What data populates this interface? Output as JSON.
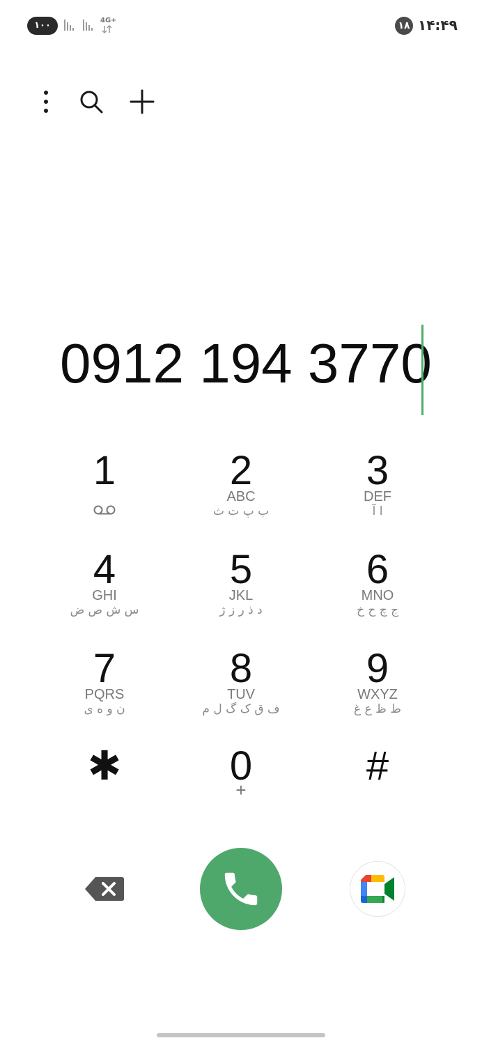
{
  "status_bar": {
    "battery": "۱۰۰",
    "network": "4G+",
    "notification_count": "۱۸",
    "time": "۱۴:۴۹"
  },
  "dialer": {
    "number": "0912 194 3770"
  },
  "keypad": {
    "keys": [
      {
        "digit": "1",
        "letters": "",
        "farsi": ""
      },
      {
        "digit": "2",
        "letters": "ABC",
        "farsi": "ب پ ت ث"
      },
      {
        "digit": "3",
        "letters": "DEF",
        "farsi": "ا آ"
      },
      {
        "digit": "4",
        "letters": "GHI",
        "farsi": "س ش ص ض"
      },
      {
        "digit": "5",
        "letters": "JKL",
        "farsi": "د ذ ر ز ژ"
      },
      {
        "digit": "6",
        "letters": "MNO",
        "farsi": "ج چ ح خ"
      },
      {
        "digit": "7",
        "letters": "PQRS",
        "farsi": "ن و ه ی"
      },
      {
        "digit": "8",
        "letters": "TUV",
        "farsi": "ف ق ک گ ل م"
      },
      {
        "digit": "9",
        "letters": "WXYZ",
        "farsi": "ط ظ ع غ"
      },
      {
        "digit": "✱",
        "letters": "",
        "farsi": ""
      },
      {
        "digit": "0",
        "letters": "",
        "farsi": "",
        "sub": "+"
      },
      {
        "digit": "#",
        "letters": "",
        "farsi": ""
      }
    ]
  },
  "icons": {
    "voicemail": "voicemail-icon",
    "more": "more-vert-icon",
    "search": "search-icon",
    "add": "plus-icon",
    "backspace": "backspace-icon",
    "call": "phone-icon",
    "video": "google-meet-icon"
  },
  "colors": {
    "call_button": "#4fa86b",
    "cursor": "#4fae6b"
  }
}
